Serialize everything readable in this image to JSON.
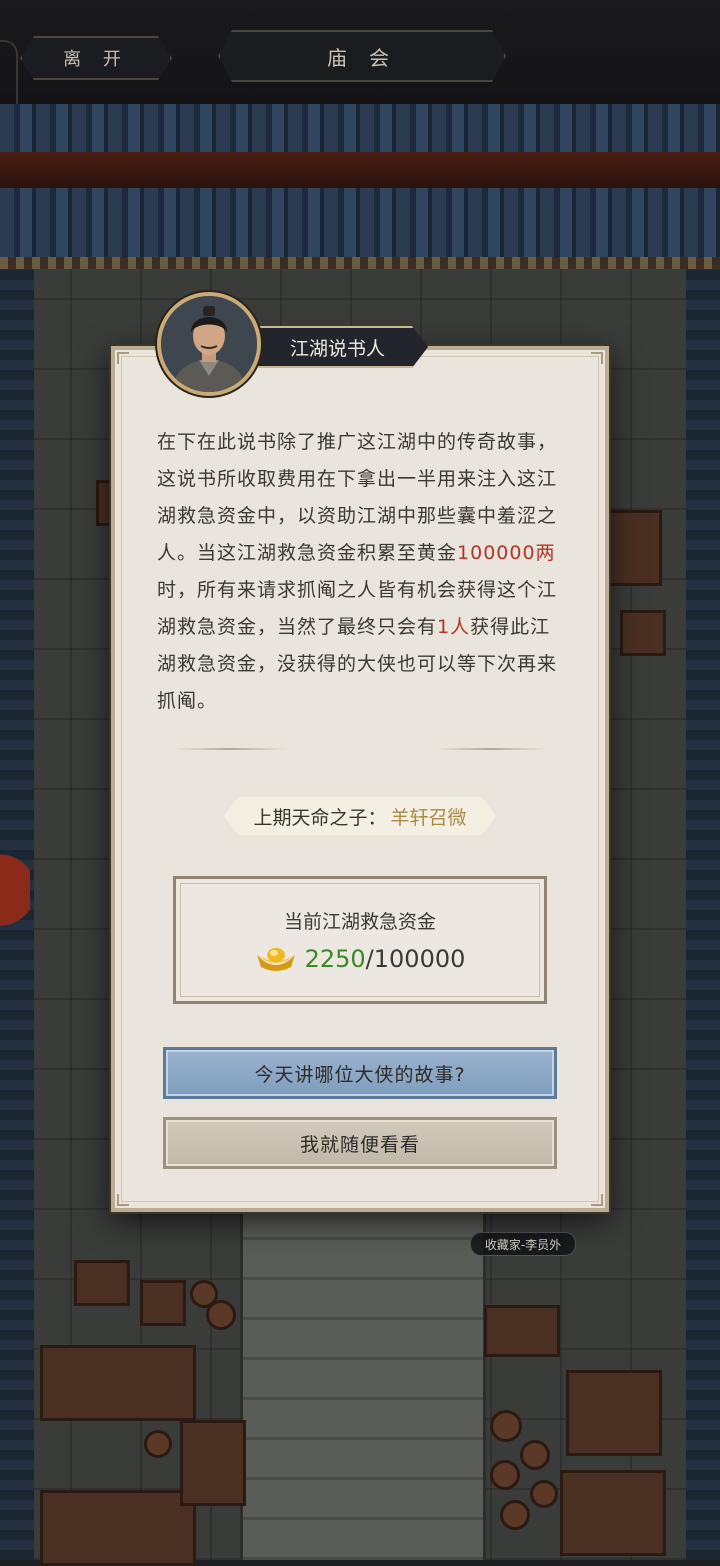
{
  "header": {
    "back_label": "离 开",
    "title": "庙 会"
  },
  "npc_tag": "收藏家-李员外",
  "dialog": {
    "speaker_name": "江湖说书人",
    "story": {
      "part1": "在下在此说书除了推广这江湖中的传奇故事，这说书所收取费用在下拿出一半用来注入这江湖救急资金中，以资助江湖中那些囊中羞涩之人。当这江湖救急资金积累至黄金",
      "highlight1": "100000两",
      "part2": "时，所有来请求抓阄之人皆有机会获得这个江湖救急资金，当然了最终只会有",
      "highlight2": "1人",
      "part3": "获得此江湖救急资金，没获得的大侠也可以等下次再来抓阄。"
    },
    "last_winner_label": "上期天命之子：",
    "last_winner_name": "羊轩召微",
    "fund": {
      "title": "当前江湖救急资金",
      "current": "2250",
      "separator": "/",
      "target": "100000",
      "icon": "gold-ingot-icon"
    },
    "primary_button": "今天讲哪位大侠的故事?",
    "secondary_button": "我就随便看看"
  },
  "colors": {
    "highlight_red": "#b43527",
    "fund_green": "#3a8a2a",
    "winner_gold": "#a78a44",
    "primary_button": "#8aa8c6"
  }
}
